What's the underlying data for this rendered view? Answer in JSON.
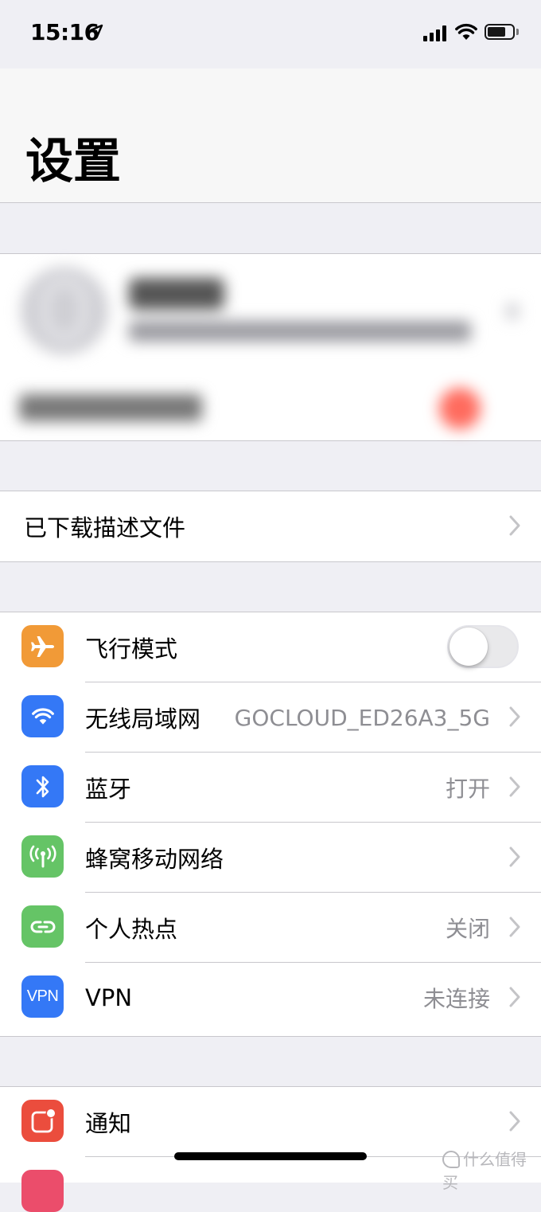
{
  "status_bar": {
    "time": "15:16"
  },
  "nav": {
    "title": "设置"
  },
  "profiles": {
    "row_label": "已下载描述文件"
  },
  "network": {
    "items": [
      {
        "label": "飞行模式",
        "value": "",
        "icon": "airplane-icon",
        "color": "#f19a37"
      },
      {
        "label": "无线局域网",
        "value": "GOCLOUD_ED26A3_5G",
        "icon": "wifi-icon",
        "color": "#3478f6"
      },
      {
        "label": "蓝牙",
        "value": "打开",
        "icon": "bluetooth-icon",
        "color": "#3478f6"
      },
      {
        "label": "蜂窝移动网络",
        "value": "",
        "icon": "cellular-icon",
        "color": "#65c466"
      },
      {
        "label": "个人热点",
        "value": "关闭",
        "icon": "hotspot-icon",
        "color": "#65c466"
      },
      {
        "label": "VPN",
        "value": "未连接",
        "icon": "vpn-icon",
        "icon_text": "VPN",
        "color": "#3478f6"
      }
    ],
    "airplane_mode_on": false
  },
  "notifications": {
    "label": "通知",
    "icon": "notifications-icon",
    "color": "#eb4d3d"
  },
  "watermark": {
    "text": "什么值得买"
  }
}
